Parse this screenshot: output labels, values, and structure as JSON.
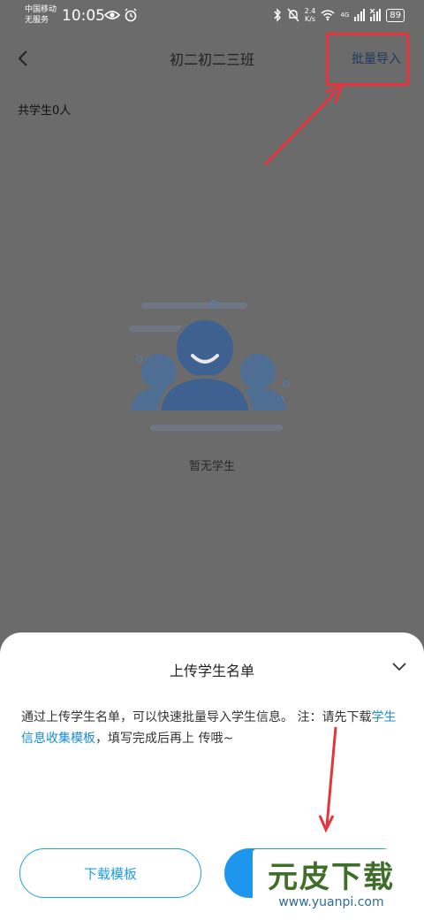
{
  "status_bar": {
    "carrier_line1": "中国移动",
    "carrier_line2": "无服务",
    "time": "10:05",
    "net_speed_top": "2.4",
    "net_speed_bottom": "K/s",
    "network_tag": "4G",
    "battery": "89"
  },
  "nav": {
    "title": "初二初二三班",
    "import_label": "批量导入"
  },
  "summary": {
    "student_count": "共学生0人"
  },
  "empty_state": {
    "text": "暂无学生"
  },
  "sheet": {
    "title": "上传学生名单",
    "desc_part1": "通过上传学生名单，可以快速批量导入学生信息。 注：请先下载",
    "desc_link": "学生信息收集模板",
    "desc_part2": "，填写完成后再上 传哦~",
    "download_button": "下载模板"
  },
  "watermark": {
    "main": "元皮下载",
    "url": "www.yuanpi.com"
  },
  "colors": {
    "annotation_red": "#e8323c",
    "accent_blue": "#1e96ee",
    "link_blue": "#1a8ddc"
  }
}
